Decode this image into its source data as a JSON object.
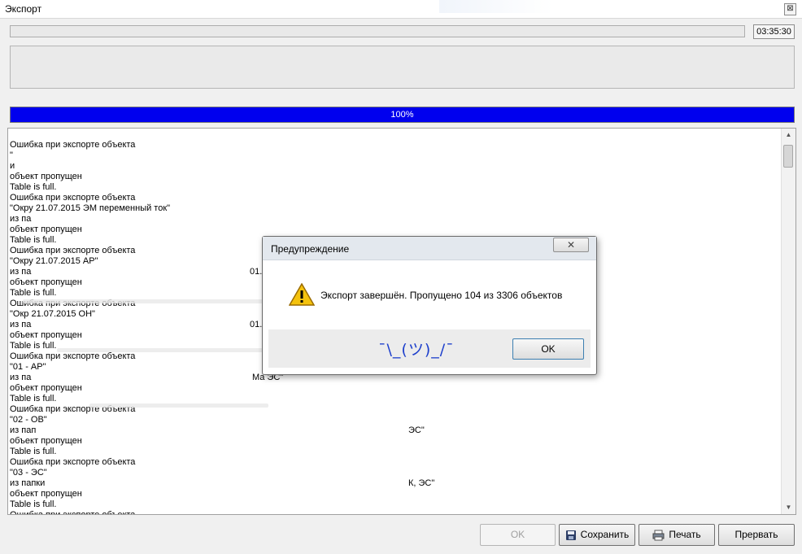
{
  "window": {
    "title": "Экспорт",
    "close_glyph": "⊠"
  },
  "timer": "03:35:30",
  "progress": {
    "percent": 100,
    "label": "100%",
    "color": "#0000ee"
  },
  "log_lines": [
    {
      "text": "Ошибка при экспорте объекта",
      "extra": ""
    },
    {
      "text": "\"",
      "extra": ""
    },
    {
      "text": "и",
      "extra": ""
    },
    {
      "text": "объект пропущен",
      "extra": ""
    },
    {
      "text": "Table is full.",
      "extra": ""
    },
    {
      "text": "Ошибка при экспорте объекта",
      "extra": ""
    },
    {
      "text": "\"Окру  21.07.2015  ЭМ переменный ток\"",
      "extra": ""
    },
    {
      "text": "из па",
      "extra": ""
    },
    {
      "text": "объект пропущен",
      "extra": ""
    },
    {
      "text": "Table is full.",
      "extra": ""
    },
    {
      "text": "Ошибка при экспорте объекта",
      "extra": ""
    },
    {
      "text": "\"Окру  21.07.2015  АР\"",
      "extra": ""
    },
    {
      "text": "из па",
      "extra": "01."
    },
    {
      "text": "объект пропущен",
      "extra": ""
    },
    {
      "text": "Table is full.",
      "extra": ""
    },
    {
      "text": "Ошибка при экспорте объекта",
      "extra": ""
    },
    {
      "text": "\"Окр  21.07.2015  ОН\"",
      "extra": ""
    },
    {
      "text": "из па",
      "extra": "01."
    },
    {
      "text": "объект пропущен",
      "extra": ""
    },
    {
      "text": "Table is full.",
      "extra": ""
    },
    {
      "text": "Ошибка при экспорте объекта",
      "extra": ""
    },
    {
      "text": "\"01 - АР\"",
      "extra": ""
    },
    {
      "text": "из па",
      "extra": "Ма  ЭС\""
    },
    {
      "text": "объект пропущен",
      "extra": ""
    },
    {
      "text": "Table is full.",
      "extra": ""
    },
    {
      "text": "Ошибка при экспорте объекта",
      "extra": ""
    },
    {
      "text": "\"02 - ОВ\"",
      "extra": ""
    },
    {
      "text": "из пап",
      "extra": "ЭС\""
    },
    {
      "text": "объект пропущен",
      "extra": ""
    },
    {
      "text": "Table is full.",
      "extra": ""
    },
    {
      "text": "Ошибка при экспорте объекта",
      "extra": ""
    },
    {
      "text": "\"03 - ЭС\"",
      "extra": ""
    },
    {
      "text": "из папки",
      "extra": "К, ЭС\""
    },
    {
      "text": "объект пропущен",
      "extra": ""
    },
    {
      "text": "Table is full.",
      "extra": ""
    },
    {
      "text": "Ошибка при экспорте объекта",
      "extra": ""
    }
  ],
  "buttons": {
    "ok": "OK",
    "save": "Сохранить",
    "print": "Печать",
    "abort": "Прервать"
  },
  "icons": {
    "save": "floppy-disk-icon",
    "print": "printer-icon",
    "warning": "warning-icon"
  },
  "dialog": {
    "title": "Предупреждение",
    "close_glyph": "✕",
    "message": "Экспорт завершён. Пропущено 104 из 3306 объектов",
    "shrug": "¯\\_(ツ)_/¯",
    "ok_label": "OK"
  }
}
